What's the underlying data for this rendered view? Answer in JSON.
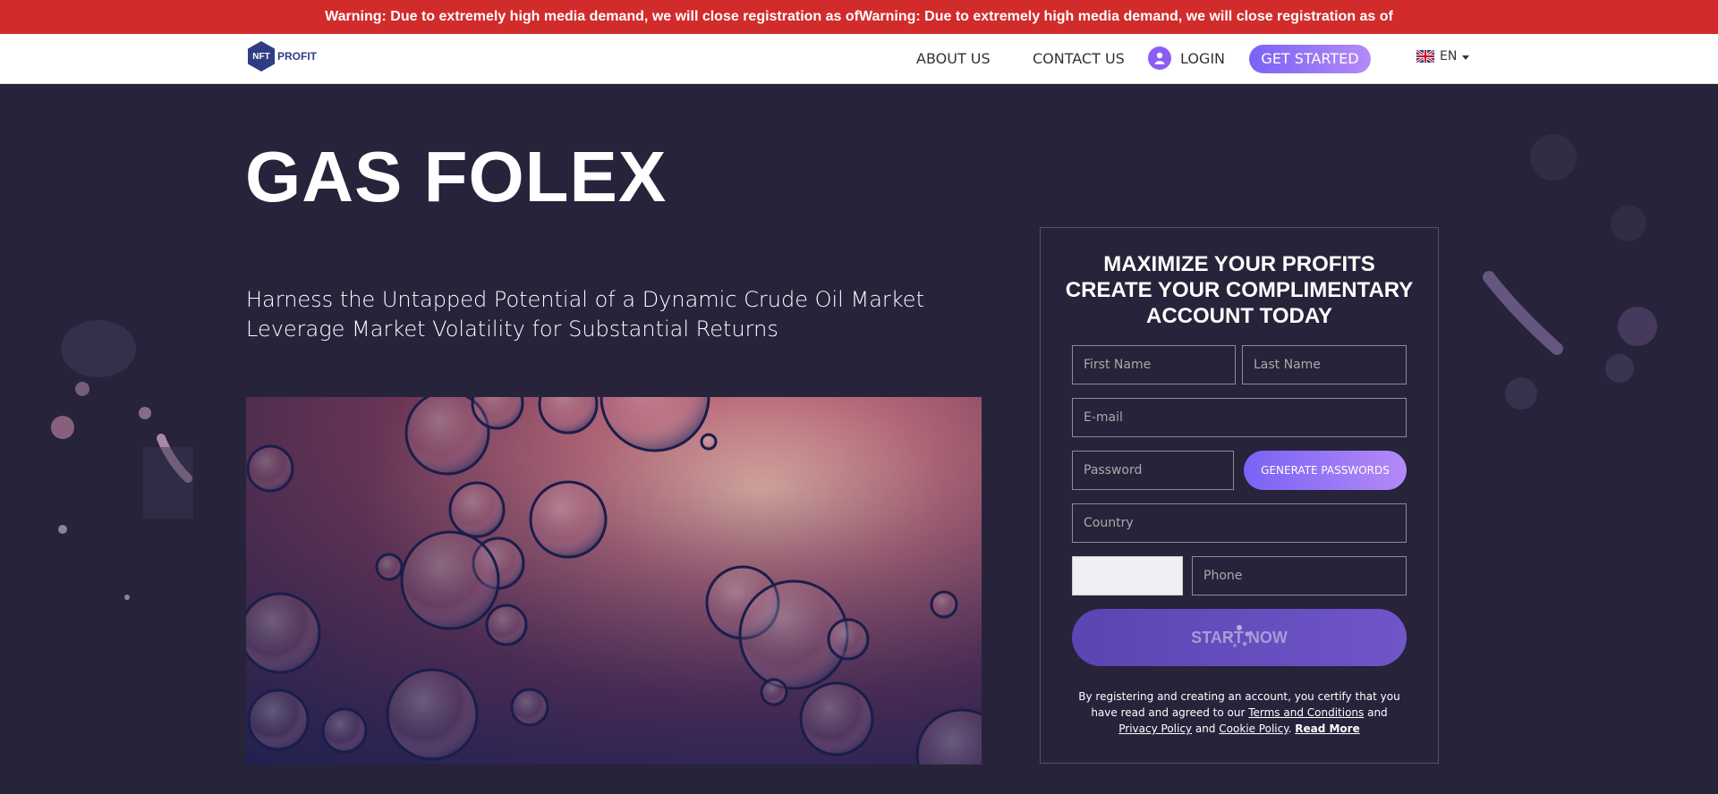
{
  "warning": {
    "text": "Warning: Due to extremely high media demand, we will close registration as ofWarning: Due to extremely high media demand, we will close registration as of"
  },
  "nav": {
    "logo_badge": "NFT",
    "logo_text": "PROFIT",
    "about": "ABOUT US",
    "contact": "CONTACT US",
    "login": "LOGIN",
    "get_started": "GET STARTED",
    "lang": "EN"
  },
  "hero": {
    "title": "GAS FOLEX",
    "subtitle_1": "Harness the Untapped Potential of a Dynamic Crude Oil Market",
    "subtitle_2": "Leverage Market Volatility for Substantial Returns"
  },
  "form": {
    "title_1": "MAXIMIZE YOUR PROFITS",
    "title_2": "CREATE YOUR COMPLIMENTARY",
    "title_3": "ACCOUNT TODAY",
    "first_name": "First Name",
    "last_name": "Last Name",
    "email": "E-mail",
    "password": "Password",
    "generate": "GENERATE PASSWORDS",
    "country": "Country",
    "phone": "Phone",
    "start": "START NOW",
    "disclaimer_pre": "By registering and creating an account, you certify that you have read and agreed to our ",
    "terms": "Terms and Conditions",
    "and1": " and ",
    "privacy": "Privacy Policy",
    "and2": " and ",
    "cookie": "Cookie Policy",
    "dot": ".  ",
    "read_more": "Read More"
  },
  "colors": {
    "warning_bg": "#d22b2b",
    "page_bg": "#26233a",
    "accent": "#7a63f5"
  }
}
